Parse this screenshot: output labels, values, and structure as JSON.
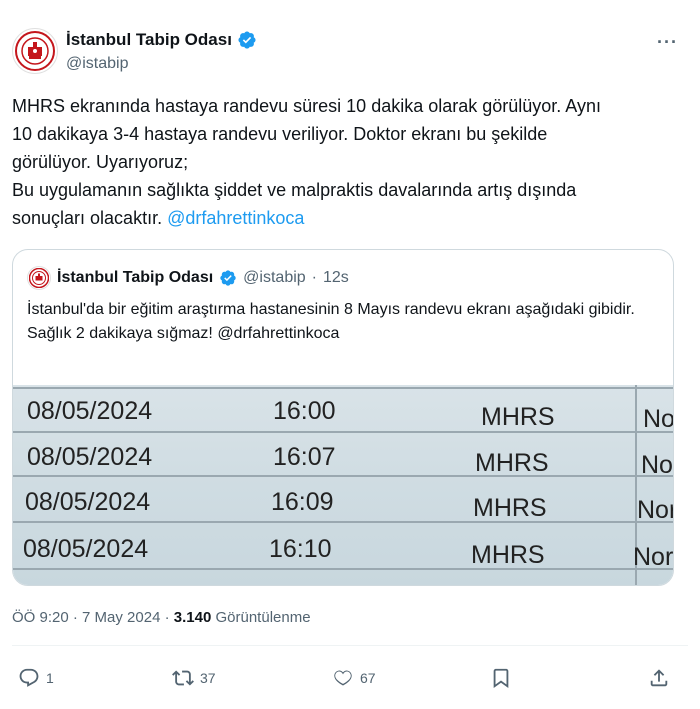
{
  "author": {
    "name": "İstanbul Tabip Odası",
    "handle": "@istabip",
    "verified": true
  },
  "more_label": "···",
  "tweet": {
    "text_lines": [
      "MHRS ekranında hastaya randevu süresi 10 dakika olarak görülüyor. Aynı",
      "10 dakikaya 3-4 hastaya randevu veriliyor. Doktor ekranı bu şekilde",
      "görülüyor. Uyarıyoruz;",
      "Bu uygulamanın sağlıkta şiddet ve malpraktis davalarında artış dışında"
    ],
    "last_line_prefix": "sonuçları olacaktır. ",
    "mention": "@drfahrettinkoca"
  },
  "quote": {
    "name": "İstanbul Tabip Odası",
    "handle": "@istabip",
    "separator": "·",
    "time": "12s",
    "text": "İstanbul'da bir eğitim araştırma hastanesinin 8 Mayıs randevu ekranı aşağıdaki gibidir.\nSağlık 2 dakikaya sığmaz! @drfahrettinkoca",
    "image_rows": [
      {
        "date": "08/05/2024",
        "time": "16:00",
        "source": "MHRS",
        "status": "No"
      },
      {
        "date": "08/05/2024",
        "time": "16:07",
        "source": "MHRS",
        "status": "No"
      },
      {
        "date": "08/05/2024",
        "time": "16:09",
        "source": "MHRS",
        "status": "Nor"
      },
      {
        "date": "08/05/2024",
        "time": "16:10",
        "source": "MHRS",
        "status": "Nor"
      }
    ]
  },
  "meta": {
    "time": "ÖÖ 9:20",
    "separator1": " · ",
    "date": "7 May 2024",
    "separator2": " · ",
    "views_count": "3.140",
    "views_label": " Görüntülenme"
  },
  "actions": {
    "replies": "1",
    "retweets": "37",
    "likes": "67"
  },
  "colors": {
    "accent": "#1d9bf0",
    "text": "#0f1419",
    "secondary": "#536471",
    "logo_red": "#c4161c"
  }
}
